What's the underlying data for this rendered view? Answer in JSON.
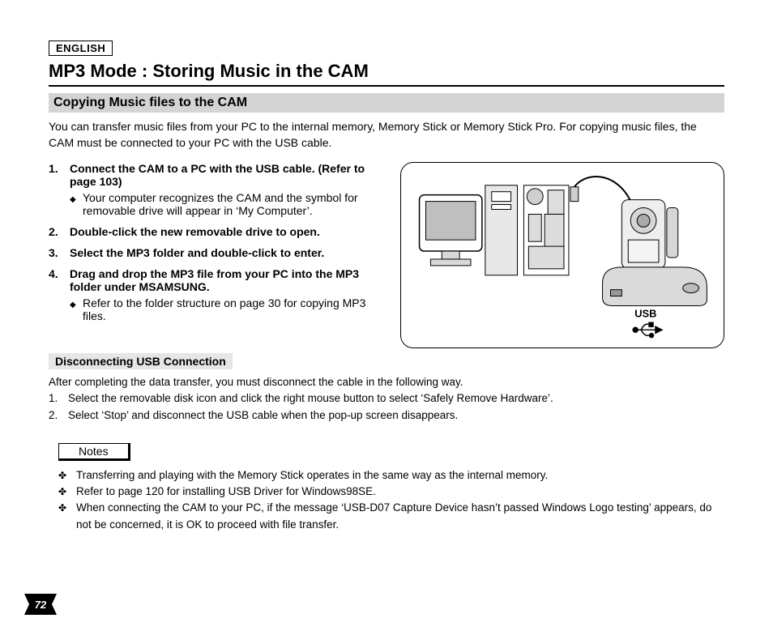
{
  "language_tag": "ENGLISH",
  "title": "MP3 Mode : Storing Music in the CAM",
  "section_heading": "Copying Music files to the CAM",
  "intro": "You can transfer music files from your PC to the internal memory, Memory Stick or Memory Stick Pro. For copying music files, the CAM must be connected to your PC with the USB cable.",
  "steps": [
    {
      "num": "1.",
      "title": "Connect the CAM to a PC with the USB cable. (Refer to page 103)",
      "bullets": [
        "Your computer recognizes the CAM and the symbol for removable drive will appear in ‘My Computer’."
      ]
    },
    {
      "num": "2.",
      "title": "Double-click the new removable drive to open.",
      "bullets": []
    },
    {
      "num": "3.",
      "title": "Select the MP3 folder and double-click to enter.",
      "bullets": []
    },
    {
      "num": "4.",
      "title": "Drag and drop the MP3 file from your PC into the MP3 folder under MSAMSUNG.",
      "bullets": [
        "Refer to the folder structure on page 30 for copying MP3 files."
      ]
    }
  ],
  "diagram": {
    "usb_label": "USB"
  },
  "disconnect": {
    "heading": "Disconnecting USB Connection",
    "intro": "After completing the data transfer, you must disconnect the cable in the following way.",
    "items": [
      {
        "num": "1.",
        "text": "Select the removable disk icon and click the right mouse button to select ‘Safely Remove Hardware’."
      },
      {
        "num": "2.",
        "text": "Select ‘Stop’ and disconnect the USB cable when the pop-up screen disappears."
      }
    ]
  },
  "notes": {
    "label": "Notes",
    "items": [
      "Transferring and playing with the Memory Stick operates in the same way as the internal memory.",
      "Refer to page 120 for installing USB Driver for Windows98SE.",
      "When connecting the CAM to your PC, if the message ‘USB-D07 Capture Device hasn’t passed Windows Logo testing’ appears, do not be concerned, it is OK to proceed with file transfer."
    ]
  },
  "page_number": "72"
}
